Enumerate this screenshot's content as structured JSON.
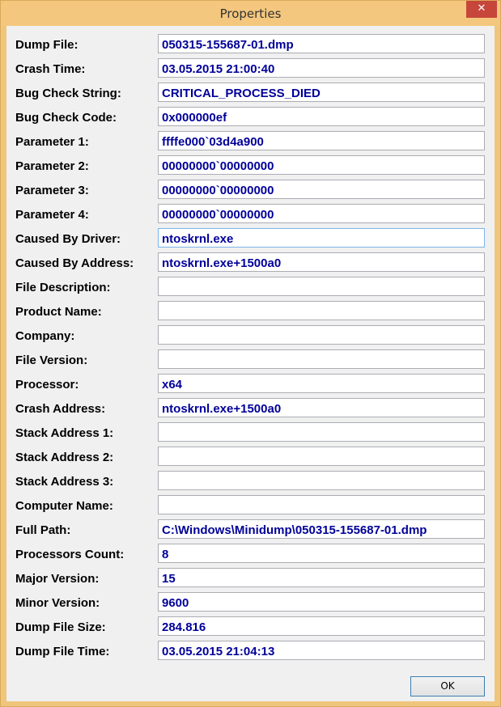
{
  "window": {
    "title": "Properties",
    "close_glyph": "✕"
  },
  "fields": [
    {
      "label": "Dump File:",
      "value": "050315-155687-01.dmp"
    },
    {
      "label": "Crash Time:",
      "value": "03.05.2015 21:00:40"
    },
    {
      "label": "Bug Check String:",
      "value": "CRITICAL_PROCESS_DIED"
    },
    {
      "label": "Bug Check Code:",
      "value": "0x000000ef"
    },
    {
      "label": "Parameter 1:",
      "value": "ffffe000`03d4a900"
    },
    {
      "label": "Parameter 2:",
      "value": "00000000`00000000"
    },
    {
      "label": "Parameter 3:",
      "value": "00000000`00000000"
    },
    {
      "label": "Parameter 4:",
      "value": "00000000`00000000"
    },
    {
      "label": "Caused By Driver:",
      "value": "ntoskrnl.exe"
    },
    {
      "label": "Caused By Address:",
      "value": "ntoskrnl.exe+1500a0"
    },
    {
      "label": "File Description:",
      "value": ""
    },
    {
      "label": "Product Name:",
      "value": ""
    },
    {
      "label": "Company:",
      "value": ""
    },
    {
      "label": "File Version:",
      "value": ""
    },
    {
      "label": "Processor:",
      "value": "x64"
    },
    {
      "label": "Crash Address:",
      "value": "ntoskrnl.exe+1500a0"
    },
    {
      "label": "Stack Address 1:",
      "value": ""
    },
    {
      "label": "Stack Address 2:",
      "value": ""
    },
    {
      "label": "Stack Address 3:",
      "value": ""
    },
    {
      "label": "Computer Name:",
      "value": ""
    },
    {
      "label": "Full Path:",
      "value": "C:\\Windows\\Minidump\\050315-155687-01.dmp"
    },
    {
      "label": "Processors Count:",
      "value": "8"
    },
    {
      "label": "Major Version:",
      "value": "15"
    },
    {
      "label": "Minor Version:",
      "value": "9600"
    },
    {
      "label": "Dump File Size:",
      "value": "284.816"
    },
    {
      "label": "Dump File Time:",
      "value": "03.05.2015 21:04:13"
    }
  ],
  "buttons": {
    "ok_label": "OK"
  },
  "colors": {
    "title_bar": "#f3c77e",
    "close_button": "#c7463b",
    "field_text": "#000099",
    "dialog_background": "#f0f0f0"
  }
}
